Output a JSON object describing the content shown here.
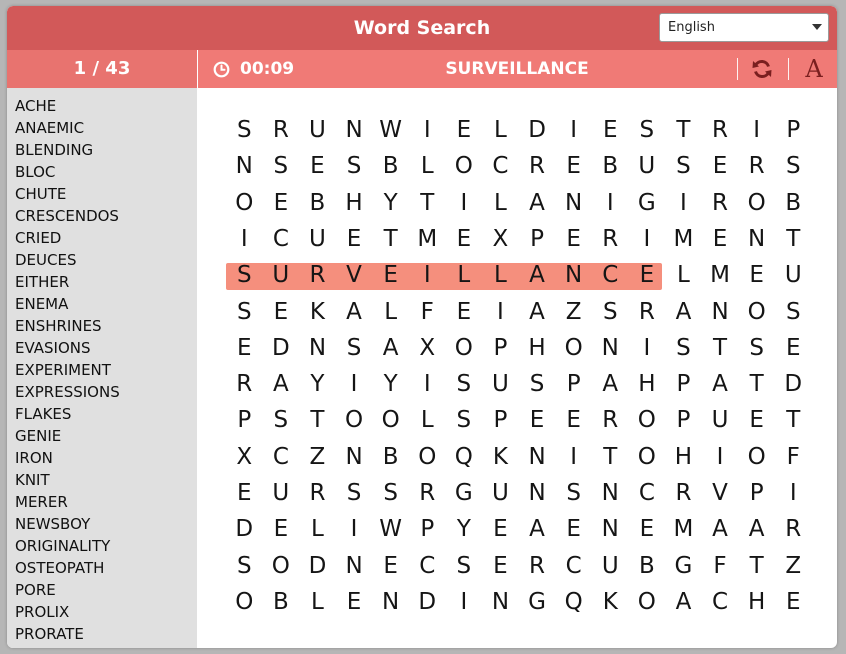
{
  "app": {
    "title": "Word Search"
  },
  "language": {
    "selected": "English"
  },
  "status": {
    "counter": "1 / 43",
    "timer": "00:09",
    "current_word": "SURVEILLANCE"
  },
  "icons": {
    "timer": "clock-icon",
    "refresh": "refresh-icon",
    "font": "font-icon"
  },
  "font_button_label": "A",
  "colors": {
    "title_bar": "#d25959",
    "info_bar": "#f07a76",
    "highlight": "#f58f7d",
    "sidebar": "#e0e0e0"
  },
  "word_list": [
    "ACHE",
    "ANAEMIC",
    "BLENDING",
    "BLOC",
    "CHUTE",
    "CRESCENDOS",
    "CRIED",
    "DEUCES",
    "EITHER",
    "ENEMA",
    "ENSHRINES",
    "EVASIONS",
    "EXPERIMENT",
    "EXPRESSIONS",
    "FLAKES",
    "GENIE",
    "IRON",
    "KNIT",
    "MERER",
    "NEWSBOY",
    "ORIGINALITY",
    "OSTEOPATH",
    "PORE",
    "PROLIX",
    "PRORATE"
  ],
  "grid": [
    "SRUNWIELDIESTRIP",
    "NSESBLOCREBUSERS",
    "OEBHYTILANIGIROB",
    "ICUETMEXPERIMENT",
    "SURVEILLANCELMEU",
    "SEKALFEIAZSRANOS",
    "EDNSAXOPHONISTSE",
    "RAYIYISUSPAHPATD",
    "PSTOOLSPEEROPUET",
    "XCZNBOQKNITOHIOF",
    "EURSSRGUNSNCRVPI",
    "DELIWPYEAENEMAAR",
    "SODNECSERCUBGFTZ",
    "OBLENDINGQKOACHE"
  ],
  "found": [
    {
      "word": "SURVEILLANCE",
      "row": 4,
      "col_start": 0,
      "col_end": 11
    }
  ]
}
